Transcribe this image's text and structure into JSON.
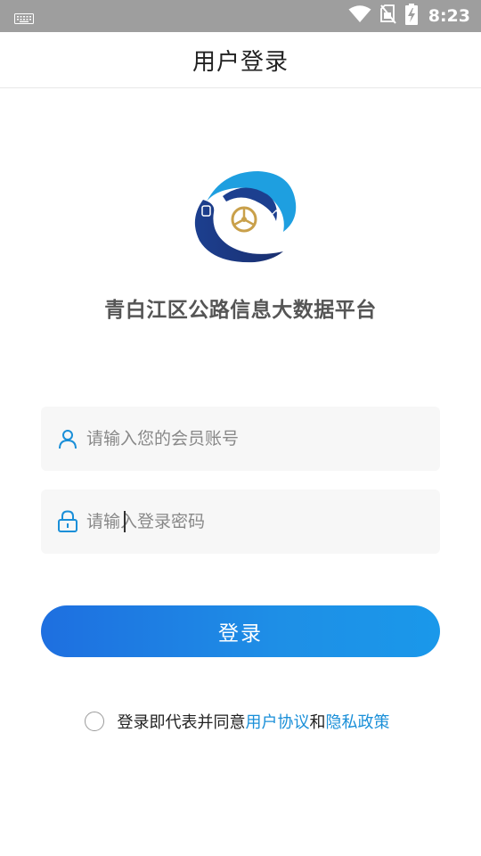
{
  "status_bar": {
    "time": "8:23",
    "icons": [
      "keyboard-icon",
      "wifi-icon",
      "no-sim-icon",
      "battery-charging-icon"
    ]
  },
  "app_bar": {
    "title": "用户登录"
  },
  "brand": {
    "app_name": "青白江区公路信息大数据平台"
  },
  "form": {
    "username": {
      "placeholder": "请输入您的会员账号",
      "value": "",
      "icon": "user-icon"
    },
    "password": {
      "placeholder": "请输入登录密码",
      "value": "",
      "icon": "lock-icon"
    },
    "login_label": "登录"
  },
  "agreement": {
    "checked": false,
    "prefix": "登录即代表并同意",
    "user_agreement": "用户协议",
    "conjunction": "和",
    "privacy_policy": "隐私政策"
  },
  "colors": {
    "accent": "#1a8fd8",
    "button_start": "#1e6fe0",
    "button_end": "#1a98ea",
    "status_bar": "#9e9e9e",
    "logo_dark": "#1c3f8f",
    "logo_light": "#1e9fe0",
    "logo_gold": "#c9a04a"
  }
}
